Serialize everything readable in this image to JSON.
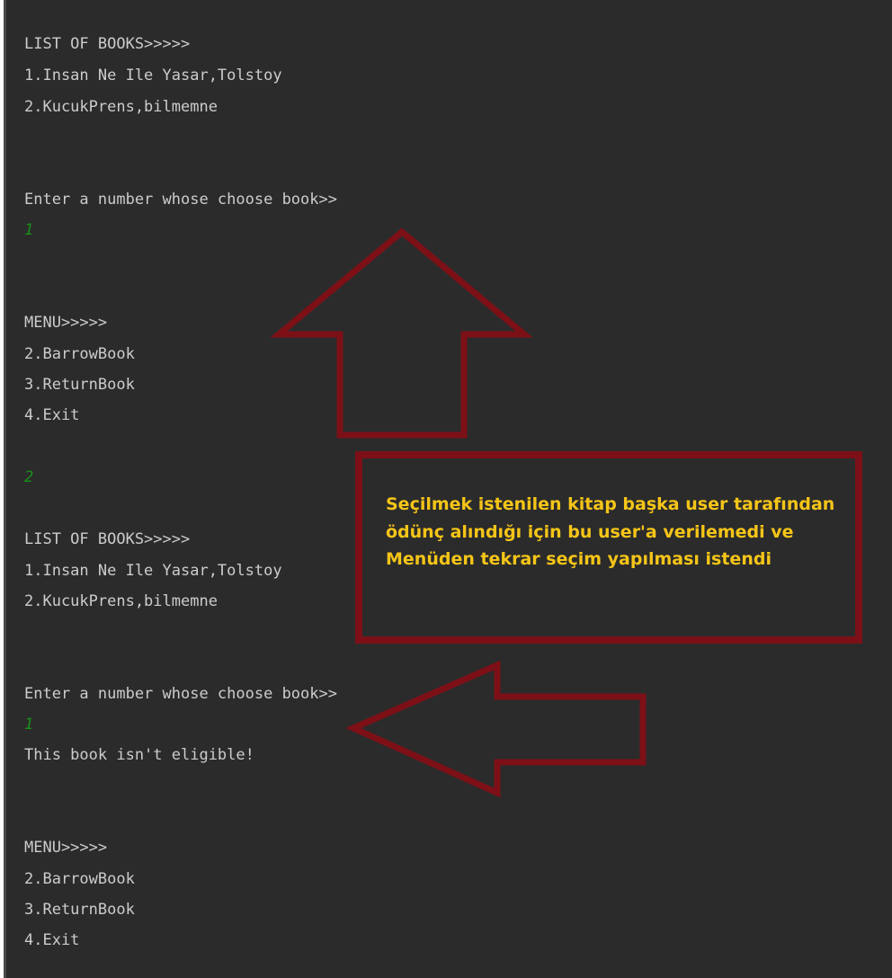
{
  "console": {
    "lines": [
      "LIST OF BOOKS>>>>>",
      "1.Insan Ne Ile Yasar,Tolstoy",
      "2.KucukPrens,bilmemne",
      "Enter a number whose choose book>>",
      "1",
      "MENU>>>>>",
      "2.BarrowBook",
      "3.ReturnBook",
      "4.Exit",
      "2",
      "LIST OF BOOKS>>>>>",
      "1.Insan Ne Ile Yasar,Tolstoy",
      "2.KucukPrens,bilmemne",
      "Enter a number whose choose book>>",
      "1",
      "This book isn't eligible!",
      "MENU>>>>>",
      "2.BarrowBook",
      "3.ReturnBook",
      "4.Exit"
    ]
  },
  "annotation": {
    "text": "Seçilmek istenilen kitap başka user tarafından ödünç alındığı için bu user'a verilemedi ve Menüden tekrar seçim yapılması istendi"
  },
  "colors": {
    "background": "#2b2b2b",
    "console_text": "#cccccc",
    "user_input": "#1a8f1a",
    "annotation_border": "#7d1017",
    "annotation_text": "#f5c518"
  }
}
